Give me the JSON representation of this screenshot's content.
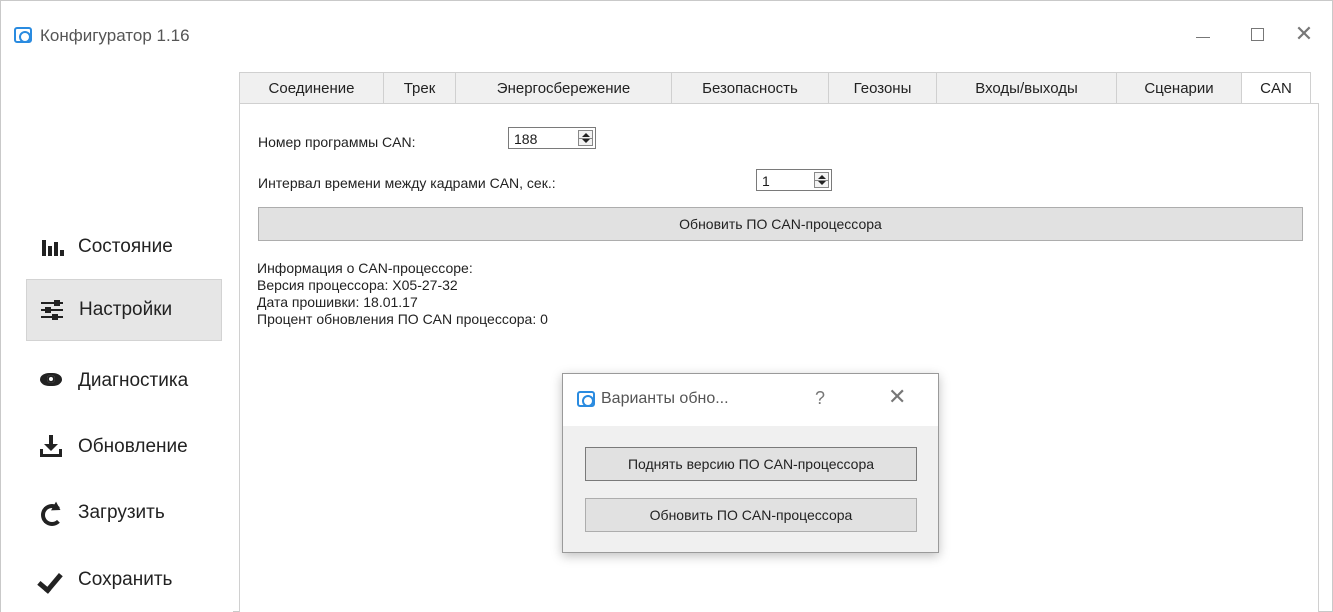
{
  "window": {
    "title": "Конфигуратор 1.16",
    "icon": "app-logo-icon",
    "minimize_glyph": "—",
    "close_glyph": "✕"
  },
  "sidebar": {
    "items": [
      {
        "label": "Состояние",
        "icon": "bar-chart-icon",
        "active": false
      },
      {
        "label": "Настройки",
        "icon": "sliders-icon",
        "active": true
      },
      {
        "label": "Диагностика",
        "icon": "eye-icon",
        "active": false
      },
      {
        "label": "Обновление",
        "icon": "download-icon",
        "active": false
      },
      {
        "label": "Загрузить",
        "icon": "refresh-icon",
        "active": false
      },
      {
        "label": "Сохранить",
        "icon": "checkmark-icon",
        "active": false
      }
    ]
  },
  "tabs": [
    {
      "label": "Соединение",
      "active": false
    },
    {
      "label": "Трек",
      "active": false
    },
    {
      "label": "Энергосбережение",
      "active": false
    },
    {
      "label": "Безопасность",
      "active": false
    },
    {
      "label": "Геозоны",
      "active": false
    },
    {
      "label": "Входы/выходы",
      "active": false
    },
    {
      "label": "Сценарии",
      "active": false
    },
    {
      "label": "CAN",
      "active": true
    }
  ],
  "can": {
    "program_label": "Номер программы CAN:",
    "program_value": "188",
    "interval_label": "Интервал времени между кадрами CAN, сек.:",
    "interval_value": "1",
    "update_button": "Обновить ПО CAN-процессора",
    "info_lines": [
      "Информация о CAN-процессоре:",
      "Версия процессора: X05-27-32",
      "Дата прошивки: 18.01.17",
      "Процент обновления ПО CAN процессора: 0"
    ]
  },
  "dialog": {
    "title": "Варианты обно...",
    "help_glyph": "?",
    "close_glyph": "✕",
    "upgrade_button": "Поднять версию ПО CAN-процессора",
    "update_button": "Обновить ПО CAN-процессора"
  },
  "colors": {
    "accent": "#2a8be0",
    "active_sidebar_bg": "#e6e6e6",
    "button_bg": "#e1e1e1"
  }
}
